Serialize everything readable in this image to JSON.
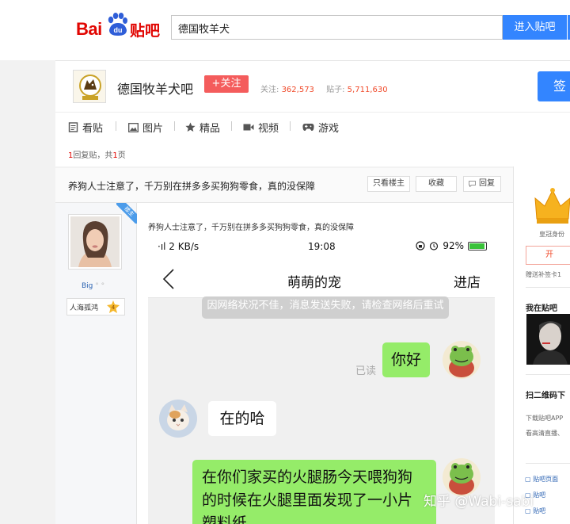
{
  "header": {
    "logo_bai": "Bai",
    "logo_du": "du",
    "logo_tieba": "贴吧",
    "search_value": "德国牧羊犬",
    "search_button": "进入贴吧"
  },
  "forum": {
    "name": "德国牧羊犬吧",
    "follow_label": "+关注",
    "followers_label": "关注:",
    "followers_value": "362,573",
    "posts_label": "贴子:",
    "posts_value": "5,711,630",
    "sign_label": "签"
  },
  "nav": {
    "items": [
      {
        "label": "看贴",
        "icon": "document-icon"
      },
      {
        "label": "图片",
        "icon": "image-icon"
      },
      {
        "label": "精品",
        "icon": "star-icon"
      },
      {
        "label": "视频",
        "icon": "video-icon"
      },
      {
        "label": "游戏",
        "icon": "gamepad-icon"
      }
    ]
  },
  "pager": {
    "replies_num": "1",
    "replies_text": "回复贴，共",
    "pages_num": "1",
    "pages_text": "页"
  },
  "thread": {
    "title": "养狗人士注意了，千万别在拼多多买狗狗零食，真的没保障",
    "only_op": "只看楼主",
    "collect": "收藏",
    "reply": "回复"
  },
  "author": {
    "louzhu_badge": "楼主",
    "name": "Big",
    "name_suffix": "° °",
    "badge_label": "人海孤鸿",
    "badge_level": "4"
  },
  "post": {
    "title": "养狗人士注意了，千万别在拼多多买狗狗零食，真的没保障"
  },
  "phone": {
    "status_left": "·ıl 2 KB/s",
    "status_time": "19:08",
    "status_battery": "92%",
    "chat_name": "萌萌的宠",
    "enter_shop": "进店",
    "system_msg": "因网络状况不佳，消息发送失败，请检查网络后重试",
    "read_label": "已读",
    "msg_hello": "你好",
    "msg_reply": "在的哈",
    "msg_complaint": "在你们家买的火腿肠今天喂狗狗的时候在火腿里面发现了一小片塑料纸"
  },
  "right": {
    "crown_label": "皇冠身份",
    "crown_button": "开",
    "sign_card_text": "赠送补签卡1",
    "my_forum_title": "我在贴吧",
    "qr_title": "扫二维码下",
    "download_line1": "下载贴吧APP",
    "download_line2": "看高清直播、",
    "link1": "贴吧页面",
    "link2": "贴吧",
    "link3": "贴吧"
  },
  "watermark": "知乎 @Wabi-sabi",
  "colors": {
    "brand_red": "#e10602",
    "brand_blue": "#3385ff",
    "follow_red": "#f45c5c",
    "wechat_green": "#95ec69"
  }
}
